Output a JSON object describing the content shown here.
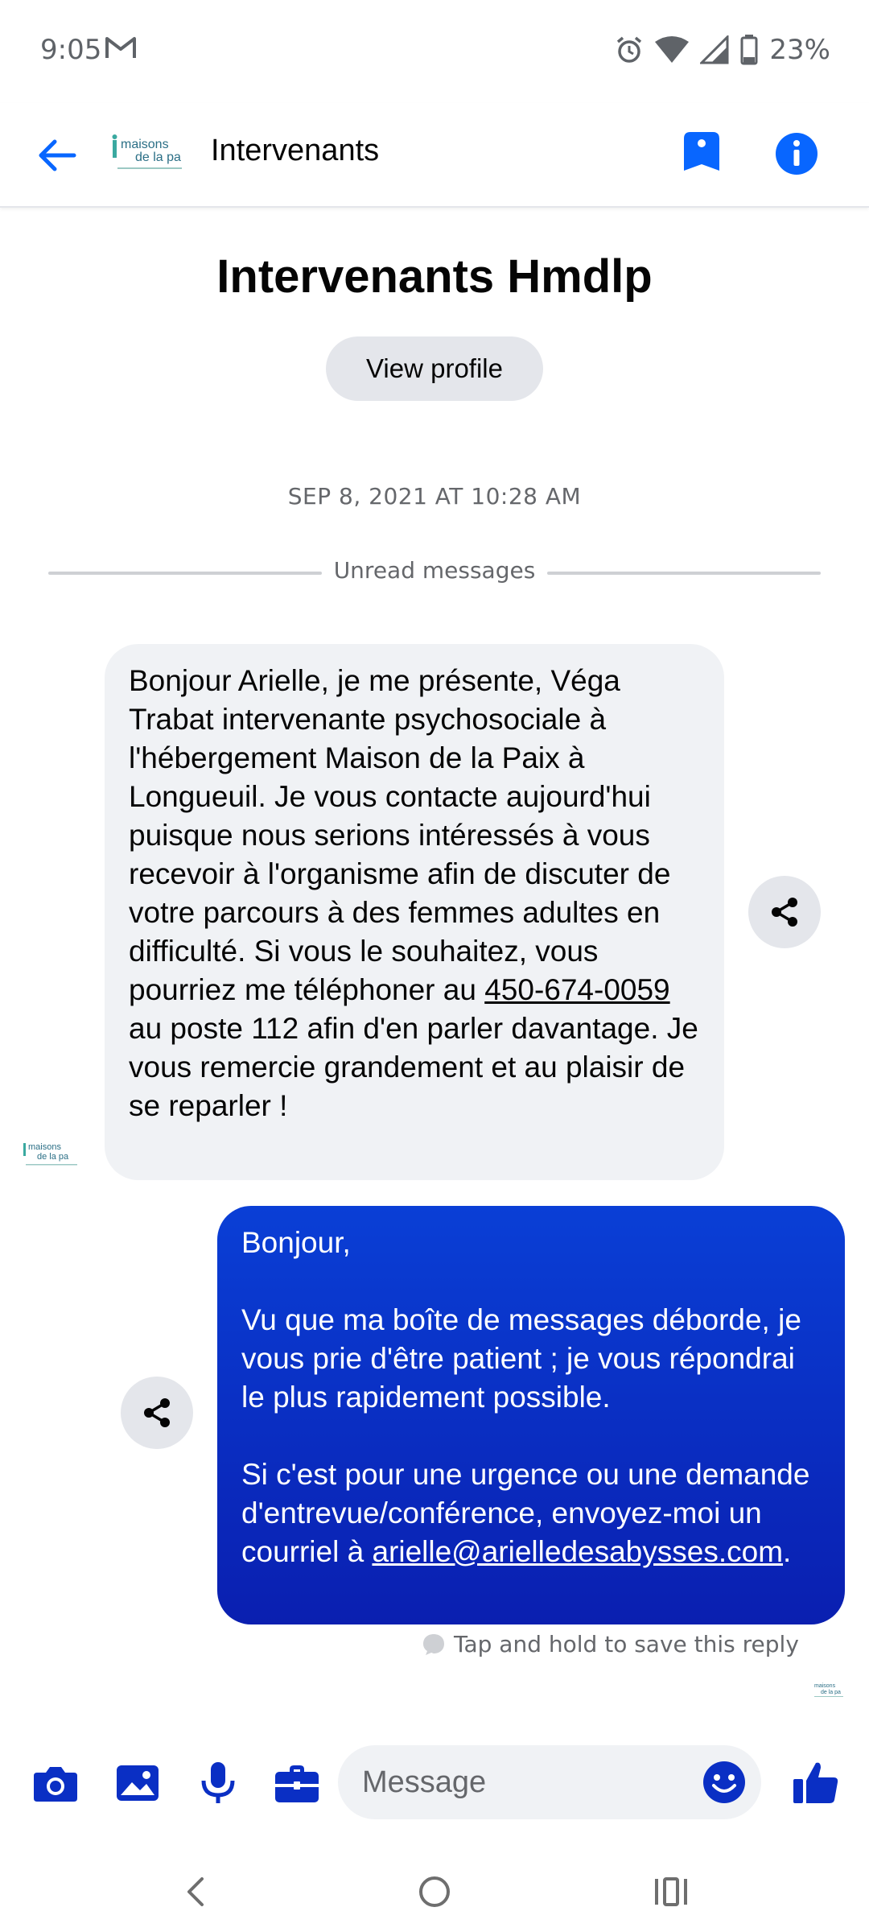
{
  "status_bar": {
    "time": "9:05",
    "battery": "23%",
    "icons": [
      "gmail-icon",
      "alarm-icon",
      "wifi-icon",
      "signal-icon",
      "battery-icon"
    ]
  },
  "header": {
    "title": "Intervenants",
    "avatar_text_line1": "maisons",
    "avatar_text_line2": "de la pa",
    "accent_color": "#0866ff"
  },
  "profile": {
    "name": "Intervenants Hmdlp",
    "view_profile_label": "View profile"
  },
  "conversation": {
    "timestamp": "SEP 8, 2021 AT 10:28 AM",
    "unread_label": "Unread messages",
    "incoming": {
      "text_before_phone": "Bonjour Arielle, je me présente, Véga Trabat intervenante psychosociale à l'hébergement Maison de la Paix à Longueuil. Je vous contacte aujourd'hui puisque nous serions intéressés à vous recevoir à l'organisme afin de discuter de votre parcours à des femmes adultes en difficulté. Si vous le souhaitez, vous pourriez me téléphoner au ",
      "phone": "450-674-0059",
      "text_after_phone": " au poste 112 afin d'en parler davantage. Je vous remercie grandement et au plaisir de se reparler !"
    },
    "outgoing": {
      "greeting": "Bonjour,",
      "paragraph1": "Vu que ma boîte de messages déborde, je vous prie d'être patient ; je vous répondrai le plus rapidement possible.",
      "paragraph2": "Si c'est pour une urgence ou une demande d'entrevue/conférence, envoyez-moi un courriel à ",
      "email": "arielle@arielledesabysses.com",
      "trailing": "."
    },
    "hint": "Tap and hold to save this reply",
    "outgoing_color": "#0a2fc4"
  },
  "composer": {
    "placeholder": "Message",
    "icons": [
      "camera-icon",
      "gallery-icon",
      "microphone-icon",
      "briefcase-icon",
      "emoji-icon",
      "thumbs-up-icon"
    ],
    "icon_color": "#0a2fc4"
  }
}
